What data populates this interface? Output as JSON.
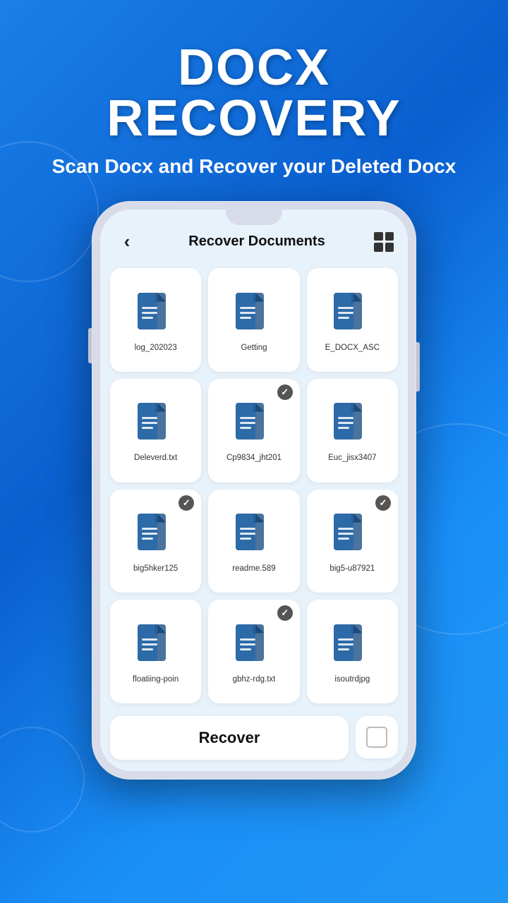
{
  "background": {
    "gradient_start": "#1a7fe8",
    "gradient_end": "#0a5fcf"
  },
  "header": {
    "title": "DOCX RECOVERY",
    "subtitle": "Scan Docx and Recover your Deleted Docx"
  },
  "screen": {
    "title": "Recover Documents",
    "back_label": "‹",
    "files": [
      {
        "name": "log_202023",
        "checked": false
      },
      {
        "name": "Getting",
        "checked": false
      },
      {
        "name": "E_DOCX_ASC",
        "checked": false
      },
      {
        "name": "Deleverd.txt",
        "checked": false
      },
      {
        "name": "Cp9834_jht201",
        "checked": true
      },
      {
        "name": "Euc_jisx3407",
        "checked": false
      },
      {
        "name": "big5hker125",
        "checked": true
      },
      {
        "name": "readme.589",
        "checked": false
      },
      {
        "name": "big5-u87921",
        "checked": true
      },
      {
        "name": "floatiing-poin",
        "checked": false
      },
      {
        "name": "gbhz-rdg.txt",
        "checked": true
      },
      {
        "name": "isoutrdjpg",
        "checked": false
      }
    ],
    "recover_button": "Recover"
  }
}
